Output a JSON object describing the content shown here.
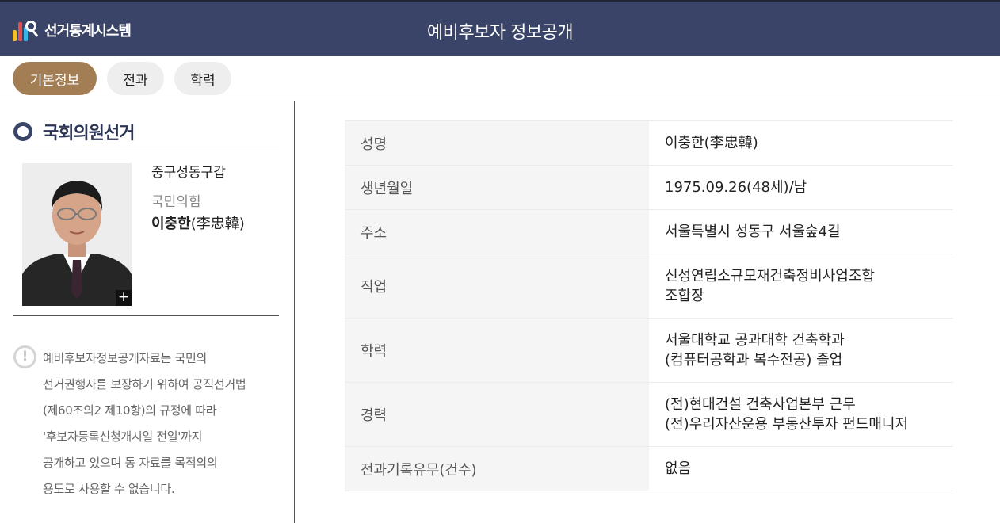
{
  "header": {
    "logo_text": "선거통계시스템",
    "page_title": "예비후보자 정보공개"
  },
  "tabs": [
    {
      "label": "기본정보",
      "active": true
    },
    {
      "label": "전과",
      "active": false
    },
    {
      "label": "학력",
      "active": false
    }
  ],
  "sidebar": {
    "section_title": "국회의원선거",
    "candidate": {
      "district": "중구성동구갑",
      "party": "국민의힘",
      "name": "이충한",
      "hanja": "(李忠韓)"
    },
    "photo_zoom_label": "+",
    "notice_icon": "!",
    "notice_lines": [
      "예비후보자정보공개자료는 국민의",
      "선거권행사를 보장하기 위하여 공직선거법",
      "(제60조의2 제10항)의 규정에 따라",
      "'후보자등록신청개시일 전일'까지",
      "공개하고 있으며 동 자료를 목적외의",
      "용도로 사용할 수 없습니다."
    ]
  },
  "info": {
    "name_label": "성명",
    "name_value": "이충한(李忠韓)",
    "birth_label": "생년월일",
    "birth_value": "1975.09.26(48세)/남",
    "address_label": "주소",
    "address_value": "서울특별시 성동구 서울숲4길",
    "job_label": "직업",
    "job_value_1": "신성연립소규모재건축정비사업조합",
    "job_value_2": "조합장",
    "edu_label": "학력",
    "edu_value_1": "서울대학교 공과대학 건축학과",
    "edu_value_2": "(컴퓨터공학과 복수전공) 졸업",
    "career_label": "경력",
    "career_value_1": "(전)현대건설 건축사업본부 근무",
    "career_value_2": "(전)우리자산운용 부동산투자 펀드매니저",
    "record_label": "전과기록유무(건수)",
    "record_value": "없음"
  },
  "colors": {
    "header_bg": "#3a4468",
    "tab_active": "#a37d54",
    "tab_inactive": "#eeeeee",
    "label_cell_bg": "#f5f5f5"
  },
  "icons": [
    "election-stats-logo-icon",
    "ring-bullet-icon",
    "notice-exclamation-icon",
    "zoom-plus-icon"
  ]
}
